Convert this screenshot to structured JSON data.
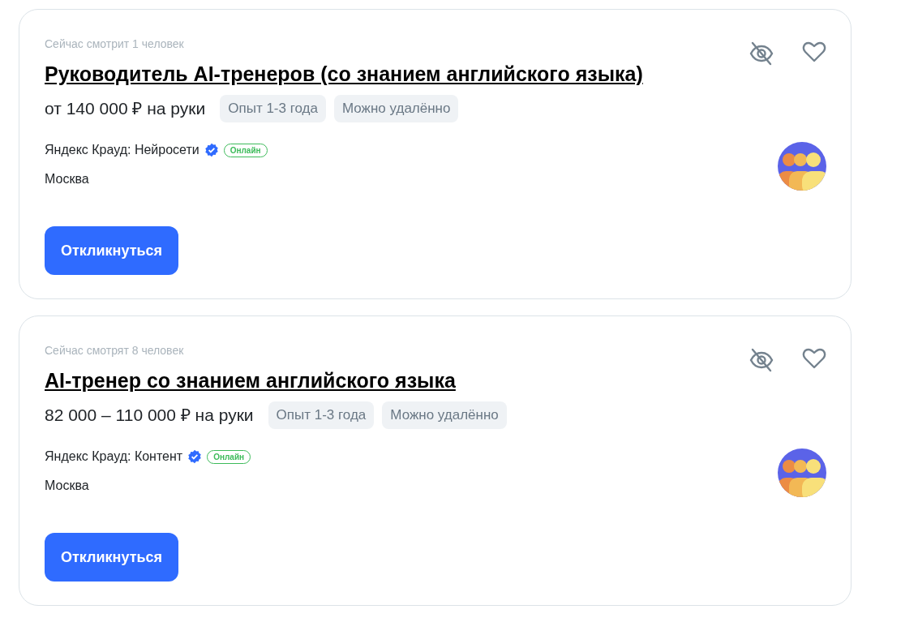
{
  "vacancies": [
    {
      "viewers": "Сейчас смотрит 1 человек",
      "title": "Руководитель AI-тренеров (со знанием английского языка)",
      "salary": "от 140 000 ₽ на руки",
      "tags": [
        "Опыт 1-3 года",
        "Можно удалённо"
      ],
      "company": "Яндекс Крауд: Нейросети",
      "verified": true,
      "status": "Онлайн",
      "city": "Москва",
      "button": "Откликнуться"
    },
    {
      "viewers": "Сейчас смотрят 8 человек",
      "title": "AI-тренер со знанием английского языка",
      "salary": "82 000 – 110 000 ₽ на руки",
      "tags": [
        "Опыт 1-3 года",
        "Можно удалённо"
      ],
      "company": "Яндекс Крауд: Контент",
      "verified": true,
      "status": "Онлайн",
      "city": "Москва",
      "button": "Откликнуться"
    }
  ]
}
